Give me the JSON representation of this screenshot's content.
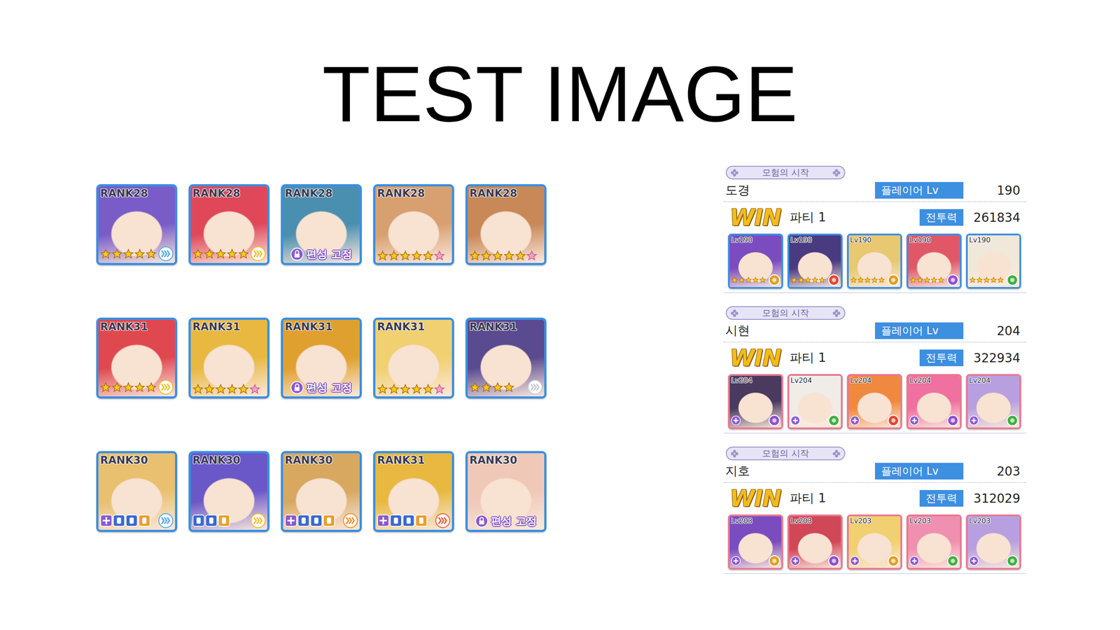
{
  "title": "TEST IMAGE",
  "roster_rows": [
    {
      "units": [
        {
          "kind": "stars",
          "rank": "RANK28",
          "color": "#7a5cc8",
          "stars": 5,
          "arrows": true,
          "arrow_color": "#5aa8e8"
        },
        {
          "kind": "stars",
          "rank": "RANK28",
          "color": "#e0485a",
          "stars": 5,
          "arrows": true,
          "arrow_color": "#f0c030"
        },
        {
          "kind": "locked",
          "rank": "RANK28",
          "color": "#4a8fb0",
          "label": "편성 고정"
        },
        {
          "kind": "stars",
          "rank": "RANK28",
          "color": "#d8a070",
          "stars": 6,
          "arrows": false,
          "arrow_color": "#f0c030"
        },
        {
          "kind": "stars",
          "rank": "RANK28",
          "color": "#c88858",
          "stars": 6,
          "arrows": false,
          "arrow_color": "#f0c030"
        }
      ]
    },
    {
      "units": [
        {
          "kind": "stars",
          "rank": "RANK31",
          "color": "#e04850",
          "stars": 5,
          "arrows": true,
          "arrow_color": "#f0c030"
        },
        {
          "kind": "stars",
          "rank": "RANK31",
          "color": "#e8b840",
          "stars": 6,
          "arrows": false,
          "arrow_color": "#f0c030"
        },
        {
          "kind": "locked",
          "rank": "RANK31",
          "color": "#e0a030",
          "label": "편성 고정"
        },
        {
          "kind": "stars",
          "rank": "RANK31",
          "color": "#f0d070",
          "stars": 6,
          "arrows": false,
          "arrow_color": "#f0c030"
        },
        {
          "kind": "stars",
          "rank": "RANK31",
          "color": "#5a4a90",
          "stars": 4,
          "arrows": true,
          "arrow_color": "#c8c8d8"
        }
      ]
    },
    {
      "units": [
        {
          "kind": "equip",
          "rank": "RANK30",
          "color": "#e8c070",
          "unique_equip": true,
          "equip_slots": 3,
          "arrows": true,
          "arrow_color": "#5aa8e8"
        },
        {
          "kind": "equip",
          "rank": "RANK30",
          "color": "#6a58c8",
          "unique_equip": false,
          "equip_slots": 3,
          "arrows": true,
          "arrow_color": "#f0c030"
        },
        {
          "kind": "equip",
          "rank": "RANK30",
          "color": "#d8a860",
          "unique_equip": true,
          "equip_slots": 3,
          "arrows": true,
          "arrow_color": "#f09030"
        },
        {
          "kind": "equip",
          "rank": "RANK31",
          "color": "#e8b840",
          "unique_equip": true,
          "equip_slots": 3,
          "arrows": true,
          "arrow_color": "#e86040"
        },
        {
          "kind": "locked",
          "rank": "RANK30",
          "color": "#f0c8b8",
          "label": "편성 고정"
        }
      ]
    }
  ],
  "records": [
    {
      "mode": "모험의 시작",
      "name": "도경",
      "level_label": "플레이어 Lv",
      "level": "190",
      "result": "WIN",
      "party": "파티 1",
      "power_label": "전투력",
      "power": "261834",
      "frame_color": "#3d8fe0",
      "units": [
        {
          "level": "Lv190",
          "stars": 5,
          "unique_equip": false,
          "color": "#7a4cc0",
          "element_color": "#e0a020"
        },
        {
          "level": "Lv190",
          "stars": 5,
          "unique_equip": false,
          "color": "#4a3a80",
          "element_color": "#e04830"
        },
        {
          "level": "Lv190",
          "stars": 5,
          "unique_equip": false,
          "color": "#e8c870",
          "element_color": "#e0a020"
        },
        {
          "level": "Lv190",
          "stars": 5,
          "unique_equip": false,
          "color": "#e05868",
          "element_color": "#9050d0"
        },
        {
          "level": "Lv190",
          "stars": 5,
          "unique_equip": false,
          "color": "#f0e8d8",
          "element_color": "#40b040"
        }
      ]
    },
    {
      "mode": "모험의 시작",
      "name": "시현",
      "level_label": "플레이어 Lv",
      "level": "204",
      "result": "WIN",
      "party": "파티 1",
      "power_label": "전투력",
      "power": "322934",
      "frame_color": "#e87890",
      "units": [
        {
          "level": "Lv204",
          "stars": 0,
          "unique_equip": true,
          "color": "#4a3a60",
          "element_color": "#9050d0"
        },
        {
          "level": "Lv204",
          "stars": 0,
          "unique_equip": true,
          "color": "#f0ece8",
          "element_color": "#40b040"
        },
        {
          "level": "Lv204",
          "stars": 0,
          "unique_equip": true,
          "color": "#f08840",
          "element_color": "#e04830"
        },
        {
          "level": "Lv204",
          "stars": 0,
          "unique_equip": true,
          "color": "#f070a0",
          "element_color": "#9050d0"
        },
        {
          "level": "Lv204",
          "stars": 0,
          "unique_equip": true,
          "color": "#b8a0e0",
          "element_color": "#40b040"
        }
      ]
    },
    {
      "mode": "모험의 시작",
      "name": "지호",
      "level_label": "플레이어 Lv",
      "level": "203",
      "result": "WIN",
      "party": "파티 1",
      "power_label": "전투력",
      "power": "312029",
      "frame_color": "#e87890",
      "units": [
        {
          "level": "Lv203",
          "stars": 0,
          "unique_equip": true,
          "color": "#7a4cc0",
          "element_color": "#e0a020"
        },
        {
          "level": "Lv203",
          "stars": 0,
          "unique_equip": true,
          "color": "#d04858",
          "element_color": "#9050d0"
        },
        {
          "level": "Lv203",
          "stars": 0,
          "unique_equip": true,
          "color": "#f0d070",
          "element_color": "#e0a020"
        },
        {
          "level": "Lv203",
          "stars": 0,
          "unique_equip": true,
          "color": "#f090b0",
          "element_color": "#40b040"
        },
        {
          "level": "Lv203",
          "stars": 0,
          "unique_equip": true,
          "color": "#b8a0e0",
          "element_color": "#40b040"
        }
      ]
    }
  ]
}
